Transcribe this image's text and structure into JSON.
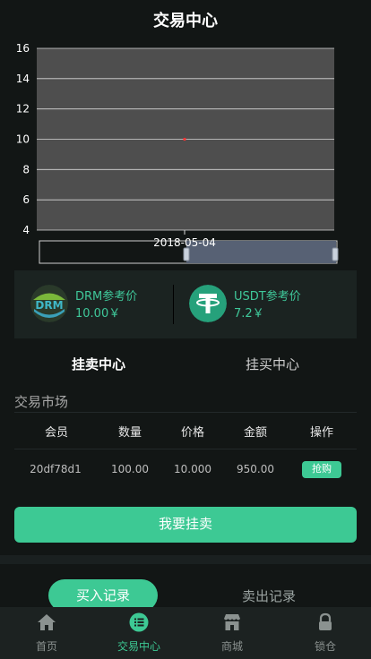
{
  "header": {
    "title": "交易中心"
  },
  "chart_data": {
    "type": "scatter",
    "title": "",
    "xlabel": "",
    "ylabel": "",
    "x": [
      "2018-05-04"
    ],
    "y": [
      10
    ],
    "ylim": [
      4,
      16
    ],
    "yticks": [
      "16",
      "14",
      "12",
      "10",
      "8",
      "6",
      "4"
    ],
    "xtick_label": "2018-05-04",
    "grid": true,
    "background_color": "#4e4e4e",
    "point_color": "#ff3333",
    "has_range_slider": true
  },
  "prices": [
    {
      "name": "DRM参考价",
      "value": "10.00￥",
      "icon": "drm-logo-icon"
    },
    {
      "name": "USDT参考价",
      "value": "7.2￥",
      "icon": "usdt-tether-icon"
    }
  ],
  "tabs": [
    {
      "label": "挂卖中心",
      "active": true
    },
    {
      "label": "挂买中心",
      "active": false
    }
  ],
  "market": {
    "title": "交易市场",
    "columns": [
      "会员",
      "数量",
      "价格",
      "金额",
      "操作"
    ],
    "rows": [
      {
        "member": "20df78d1",
        "quantity": "100.00",
        "price": "10.000",
        "amount": "950.00",
        "action": "抢购"
      }
    ]
  },
  "sell_button": "我要挂卖",
  "records": {
    "buy_label": "买入记录",
    "sell_label": "卖出记录"
  },
  "nav": [
    {
      "label": "首页",
      "icon": "home-icon",
      "active": false
    },
    {
      "label": "交易中心",
      "icon": "trade-list-icon",
      "active": true
    },
    {
      "label": "商城",
      "icon": "store-icon",
      "active": false
    },
    {
      "label": "锁仓",
      "icon": "lock-icon",
      "active": false
    }
  ],
  "colors": {
    "accent": "#3dc994",
    "background": "#121615",
    "panel": "#1b2321"
  }
}
